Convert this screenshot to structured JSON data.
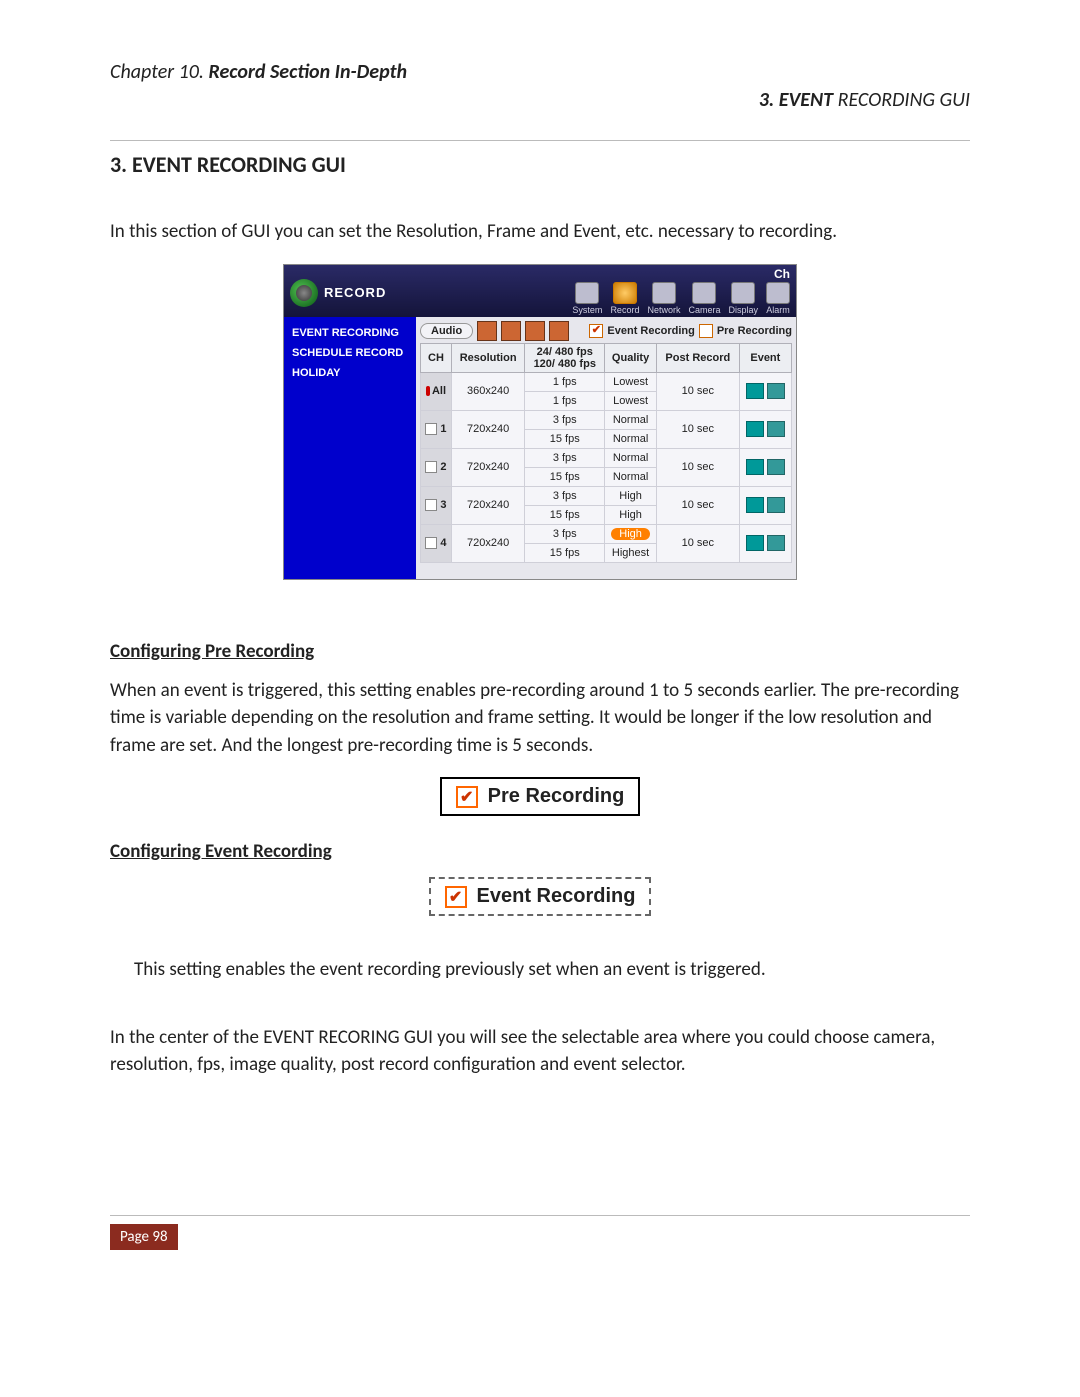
{
  "header": {
    "chapter": "Chapter 10.",
    "chapter_bold": "Record Section In-Depth",
    "right_number": "3. EVENT",
    "right_rest": " RECORDING GUI"
  },
  "section": {
    "heading": "3. EVENT RECORDING GUI",
    "intro": "In this section of GUI you can set the Resolution, Frame and Event, etc. necessary to recording."
  },
  "gui": {
    "ch_label": "Ch",
    "title": "RECORD",
    "menu": [
      "System",
      "Record",
      "Network",
      "Camera",
      "Display",
      "Alarm"
    ],
    "sidebar": [
      "EVENT RECORDING",
      "SCHEDULE RECORD",
      "HOLIDAY"
    ],
    "audio_label": "Audio",
    "event_recording": "Event Recording",
    "pre_recording": "Pre Recording",
    "event_checked": true,
    "pre_checked": false,
    "columns": {
      "ch": "CH",
      "resolution": "Resolution",
      "fps1": "24/ 480 fps",
      "fps2": "120/ 480 fps",
      "quality": "Quality",
      "post": "Post Record",
      "event": "Event"
    },
    "rows": [
      {
        "ch": "All",
        "all": true,
        "res": "360x240",
        "fpsA": "1 fps",
        "fpsB": "1 fps",
        "qualA": "Lowest",
        "qualB": "Lowest",
        "post": "10 sec",
        "evt": true
      },
      {
        "ch": "1",
        "res": "720x240",
        "fpsA": "3 fps",
        "fpsB": "15 fps",
        "qualA": "Normal",
        "qualB": "Normal",
        "post": "10 sec",
        "evt": true
      },
      {
        "ch": "2",
        "res": "720x240",
        "fpsA": "3 fps",
        "fpsB": "15 fps",
        "qualA": "Normal",
        "qualB": "Normal",
        "post": "10 sec",
        "evt": true
      },
      {
        "ch": "3",
        "res": "720x240",
        "fpsA": "3 fps",
        "fpsB": "15 fps",
        "qualA": "High",
        "qualB": "High",
        "post": "10 sec",
        "evt": true
      },
      {
        "ch": "4",
        "res": "720x240",
        "fpsA": "3 fps",
        "fpsB": "15 fps",
        "qualA": "High",
        "qualB": "Highest",
        "qualA_sel": true,
        "post": "10 sec",
        "evt": true
      }
    ]
  },
  "pre": {
    "heading": "Configuring Pre Recording",
    "p1": "When an event is triggered, this setting enables pre-recording around 1 to 5 seconds earlier. The pre-recording time is variable depending on the resolution and frame setting. It would be longer if the low resolution and frame are set. And the longest pre-recording time is 5 seconds.",
    "chk_label": "Pre Recording"
  },
  "evt": {
    "heading": "Configuring Event Recording",
    "chk_label": "Event Recording",
    "p1": "This setting enables the event recording previously set when an event is triggered.",
    "p2": "In the center of the EVENT RECORING GUI you will see the selectable area where you could choose camera, resolution, fps, image quality, post record configuration and event selector."
  },
  "footer": {
    "page": "Page 98"
  }
}
